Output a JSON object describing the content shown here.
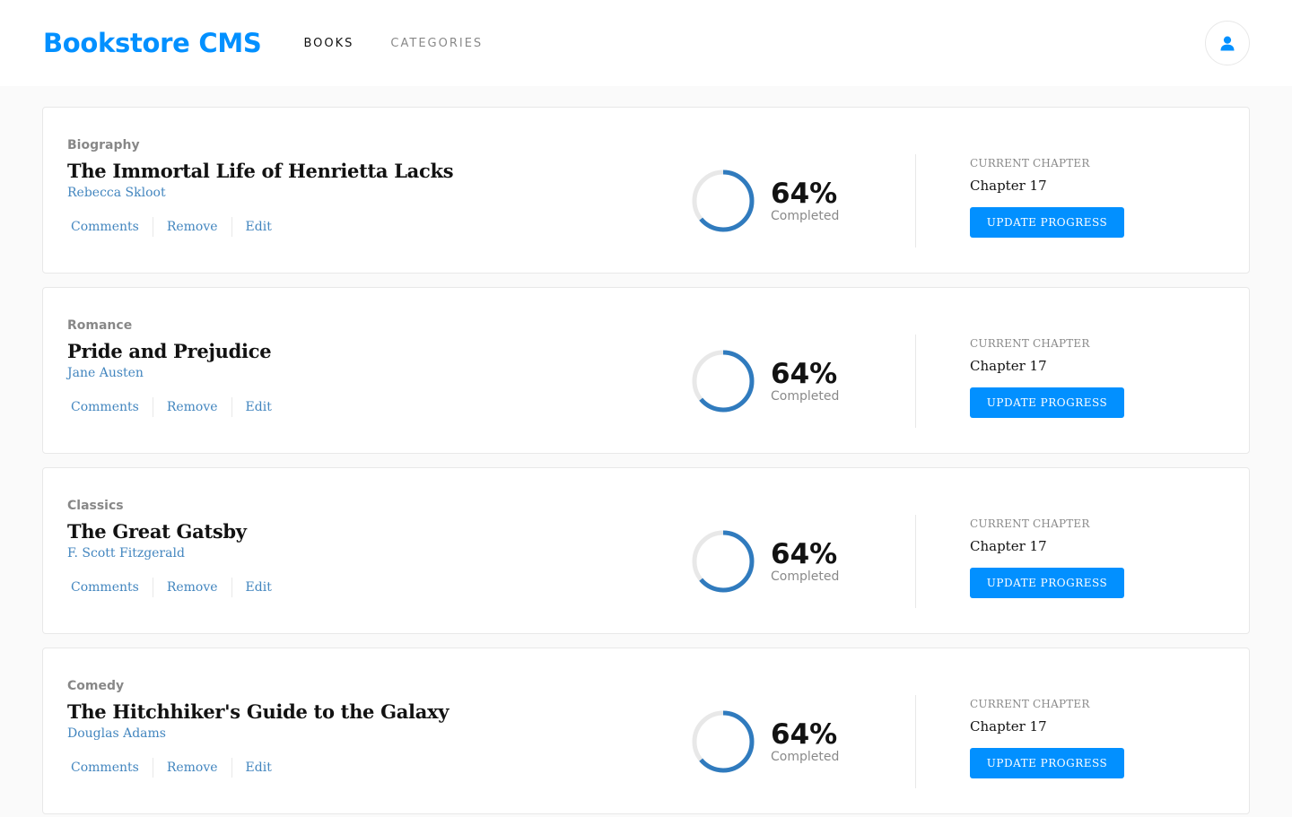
{
  "header": {
    "brand": "Bookstore CMS",
    "nav": [
      {
        "label": "BOOKS",
        "active": true
      },
      {
        "label": "CATEGORIES",
        "active": false
      }
    ],
    "user_icon": "user-icon"
  },
  "colors": {
    "accent": "#0290ff",
    "link": "#4386bf",
    "ring_track": "#e8e8e8",
    "ring_fill": "#307bbe"
  },
  "books": [
    {
      "category": "Biography",
      "title": "The Immortal Life of Henrietta Lacks",
      "author": "Rebecca Skloot",
      "actions": [
        "Comments",
        "Remove",
        "Edit"
      ],
      "progress_percent": 64,
      "progress_label": "64%",
      "completed_label": "Completed",
      "chapter_label": "CURRENT CHAPTER",
      "chapter_value": "Chapter 17",
      "button_label": "UPDATE PROGRESS"
    },
    {
      "category": "Romance",
      "title": "Pride and Prejudice",
      "author": "Jane Austen",
      "actions": [
        "Comments",
        "Remove",
        "Edit"
      ],
      "progress_percent": 64,
      "progress_label": "64%",
      "completed_label": "Completed",
      "chapter_label": "CURRENT CHAPTER",
      "chapter_value": "Chapter 17",
      "button_label": "UPDATE PROGRESS"
    },
    {
      "category": "Classics",
      "title": "The Great Gatsby",
      "author": "F. Scott Fitzgerald",
      "actions": [
        "Comments",
        "Remove",
        "Edit"
      ],
      "progress_percent": 64,
      "progress_label": "64%",
      "completed_label": "Completed",
      "chapter_label": "CURRENT CHAPTER",
      "chapter_value": "Chapter 17",
      "button_label": "UPDATE PROGRESS"
    },
    {
      "category": "Comedy",
      "title": "The Hitchhiker's Guide to the Galaxy",
      "author": "Douglas Adams",
      "actions": [
        "Comments",
        "Remove",
        "Edit"
      ],
      "progress_percent": 64,
      "progress_label": "64%",
      "completed_label": "Completed",
      "chapter_label": "CURRENT CHAPTER",
      "chapter_value": "Chapter 17",
      "button_label": "UPDATE PROGRESS"
    }
  ]
}
